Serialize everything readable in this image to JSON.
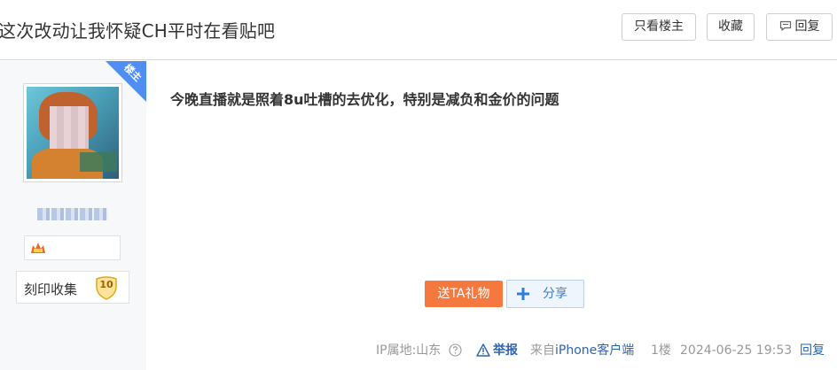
{
  "header": {
    "title": "这次改动让我怀疑CH平时在看贴吧",
    "only_louzhu_label": "只看楼主",
    "favorite_label": "收藏",
    "reply_label": "回复"
  },
  "author": {
    "badge_text": "楼主",
    "level_icon": "level-badge-icon",
    "seal_label": "刻印收集",
    "seal_count": "10"
  },
  "post": {
    "content": "今晚直播就是照着8u吐槽的去优化，特别是减负和金价的问题",
    "gift_label": "送TA礼物",
    "share_label": "分享"
  },
  "footer": {
    "ip_location": "IP属地:山东",
    "report_label": "举报",
    "from_prefix": "来自",
    "client_name": "iPhone客户端",
    "floor": "1楼",
    "timestamp": "2024-06-25 19:53",
    "reply_label": "回复"
  },
  "colors": {
    "accent_blue": "#2d64b3",
    "gift_orange": "#f5793f",
    "louzhu_badge": "#4f8ef2"
  }
}
